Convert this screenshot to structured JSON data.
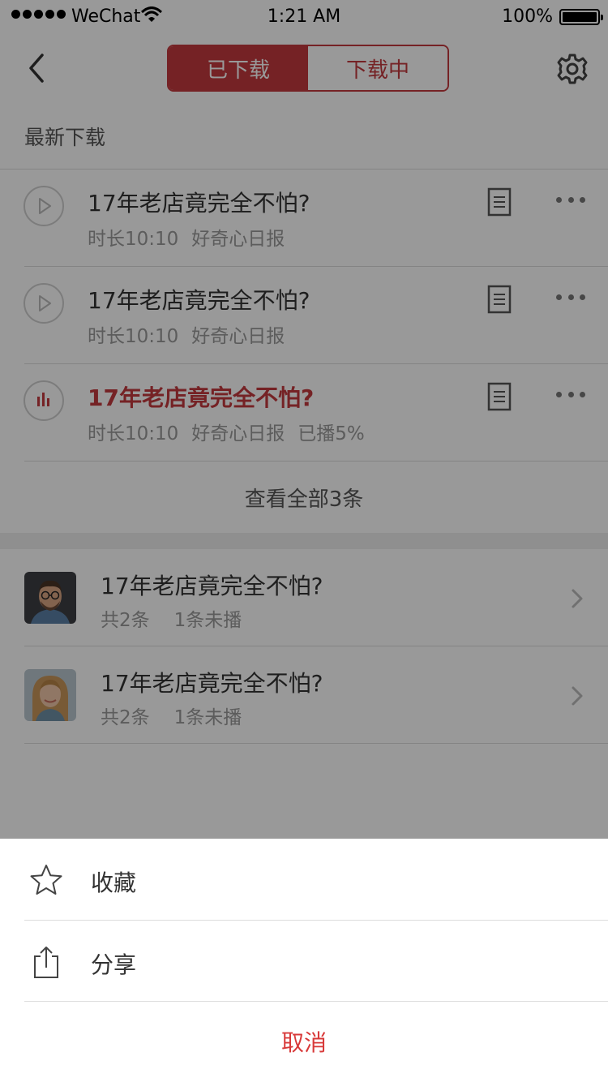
{
  "status_bar": {
    "carrier": "WeChat",
    "time": "1:21 AM",
    "battery": "100%"
  },
  "nav": {
    "tabs": [
      {
        "label": "已下载",
        "active": true
      },
      {
        "label": "下载中",
        "active": false
      }
    ]
  },
  "section": {
    "title": "最新下载"
  },
  "downloads": [
    {
      "title": "17年老店竟完全不怕?",
      "duration": "时长10:10",
      "source": "好奇心日报",
      "progress": "",
      "state": "paused"
    },
    {
      "title": "17年老店竟完全不怕?",
      "duration": "时长10:10",
      "source": "好奇心日报",
      "progress": "",
      "state": "paused"
    },
    {
      "title": "17年老店竟完全不怕?",
      "duration": "时长10:10",
      "source": "好奇心日报",
      "progress": "已播5%",
      "state": "playing"
    }
  ],
  "view_all": "查看全部3条",
  "playlists": [
    {
      "title": "17年老店竟完全不怕?",
      "count": "共2条",
      "unplayed": "1条未播",
      "avatar": "man-avatar"
    },
    {
      "title": "17年老店竟完全不怕?",
      "count": "共2条",
      "unplayed": "1条未播",
      "avatar": "woman-avatar"
    }
  ],
  "action_sheet": {
    "favorite": "收藏",
    "share": "分享",
    "cancel": "取消"
  },
  "colors": {
    "accent": "#c33a3e",
    "cancel": "#d83a3a",
    "overlay": "rgba(0,0,0,0.40)"
  }
}
